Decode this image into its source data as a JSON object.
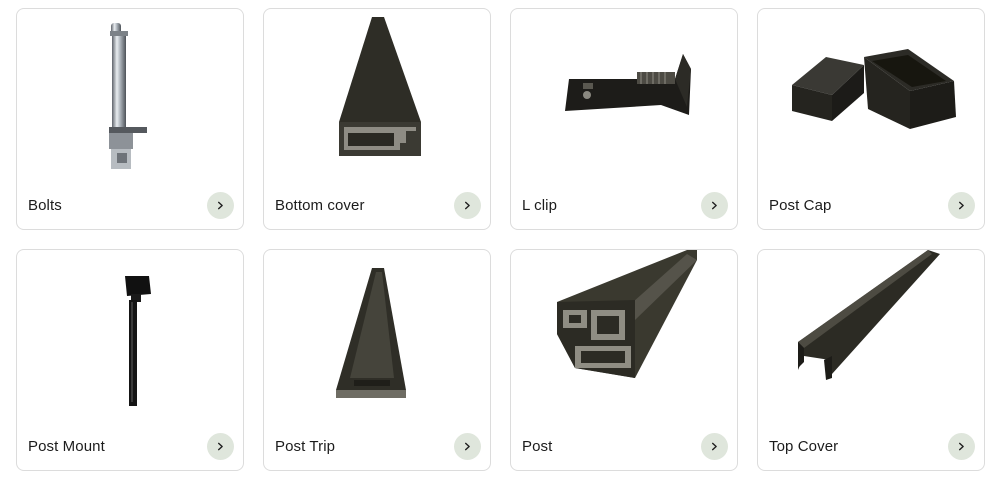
{
  "products": [
    {
      "label": "Bolts",
      "image_icon": "bolt-image",
      "arrow_icon": "chevron-right-icon"
    },
    {
      "label": "Bottom cover",
      "image_icon": "bottom-cover-image",
      "arrow_icon": "chevron-right-icon"
    },
    {
      "label": "L clip",
      "image_icon": "l-clip-image",
      "arrow_icon": "chevron-right-icon"
    },
    {
      "label": "Post Cap",
      "image_icon": "post-cap-image",
      "arrow_icon": "chevron-right-icon"
    },
    {
      "label": "Post Mount",
      "image_icon": "post-mount-image",
      "arrow_icon": "chevron-right-icon"
    },
    {
      "label": "Post Trip",
      "image_icon": "post-trip-image",
      "arrow_icon": "chevron-right-icon"
    },
    {
      "label": "Post",
      "image_icon": "post-profile-image",
      "arrow_icon": "chevron-right-icon"
    },
    {
      "label": "Top Cover",
      "image_icon": "top-cover-image",
      "arrow_icon": "chevron-right-icon"
    }
  ],
  "colors": {
    "card_border": "#dcdcdc",
    "arrow_background": "#dfe6dc",
    "product_dark": "#2b2a24",
    "chrome": "#9aa0a6"
  }
}
